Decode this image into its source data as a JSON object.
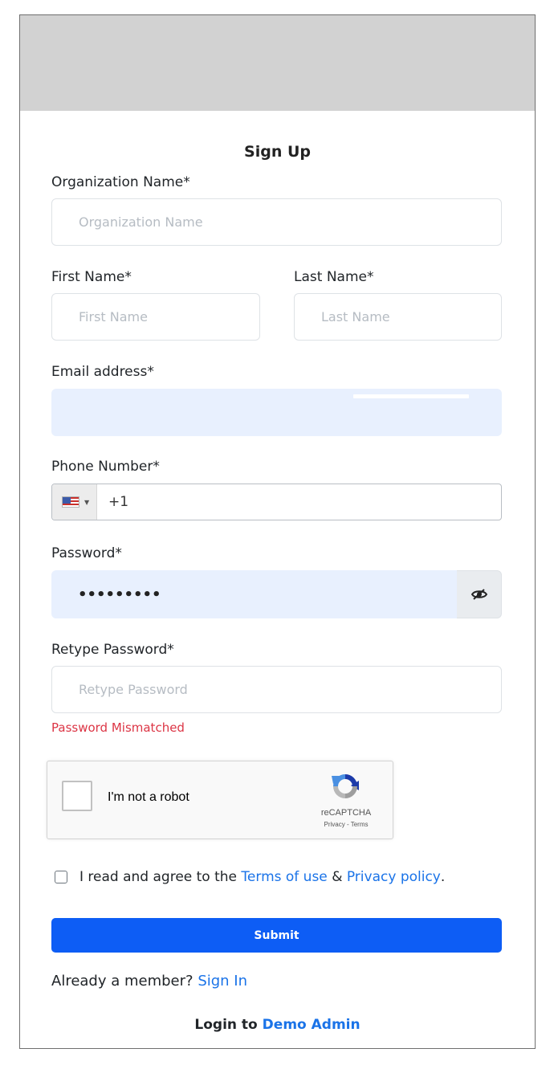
{
  "form": {
    "title": "Sign Up",
    "org_label": "Organization Name*",
    "org_placeholder": "Organization Name",
    "first_label": "First Name*",
    "first_placeholder": "First Name",
    "last_label": "Last Name*",
    "last_placeholder": "Last Name",
    "email_label": "Email address*",
    "phone_label": "Phone Number*",
    "phone_dial_code": "+1",
    "phone_flag_icon": "us-flag-icon",
    "password_label": "Password*",
    "password_value": "•••••••••",
    "password_toggle_icon": "eye-slash-icon",
    "retype_label": "Retype Password*",
    "retype_placeholder": "Retype Password",
    "error_text": "Password Mismatched"
  },
  "captcha": {
    "label": "I'm not a robot",
    "brand": "reCAPTCHA",
    "links": "Privacy - Terms"
  },
  "terms": {
    "prefix": "I read and agree to the",
    "terms_link": "Terms of use",
    "ampersand": "&",
    "privacy_link": "Privacy policy",
    "suffix": "."
  },
  "actions": {
    "submit_label": "Submit",
    "member_text": "Already a member?",
    "sign_in_link": "Sign In",
    "login_prefix": "Login to",
    "demo_link": "Demo Admin"
  },
  "colors": {
    "accent": "#0d5df5",
    "link": "#1a73e8",
    "error": "#dc3545",
    "autofill_bg": "#e8f0fe",
    "banner": "#d2d2d2"
  }
}
